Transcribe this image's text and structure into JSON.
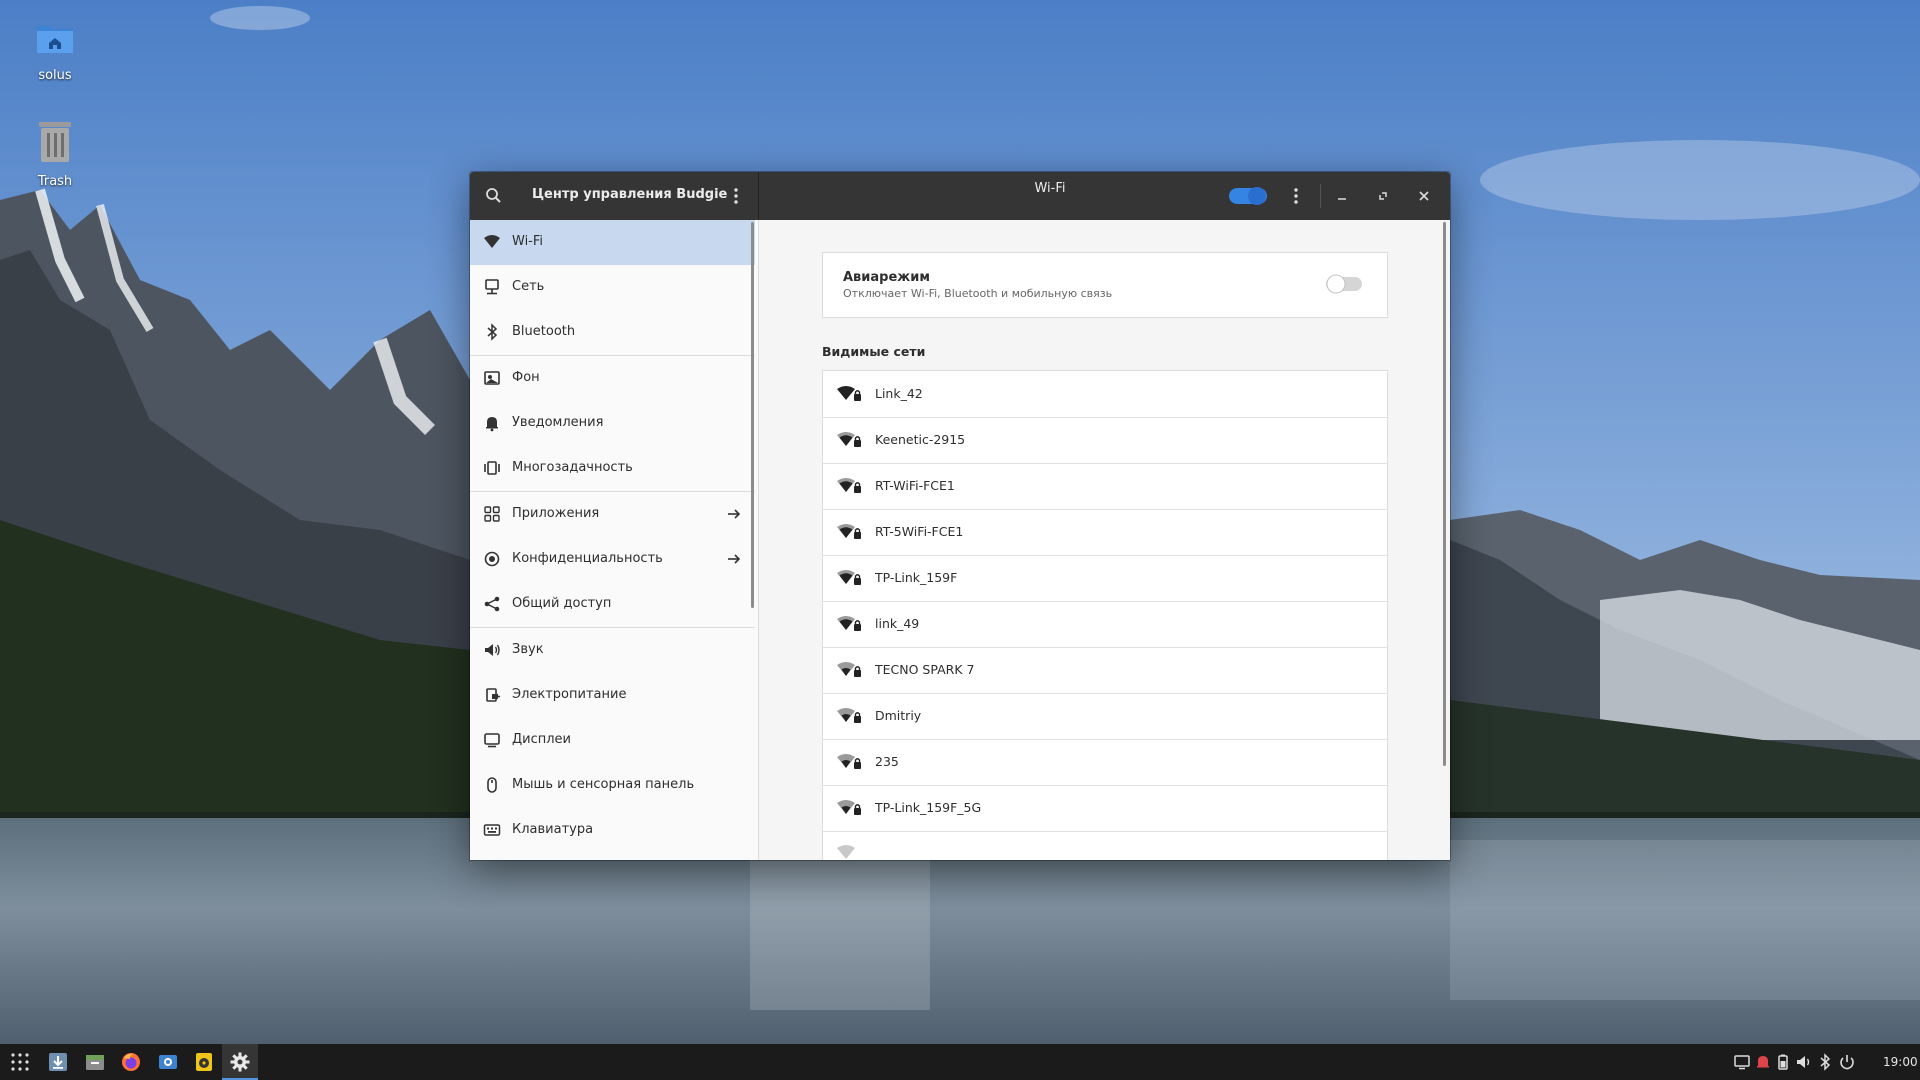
{
  "desktop": {
    "icons": [
      {
        "label": "solus",
        "icon": "home-folder-icon"
      },
      {
        "label": "Trash",
        "icon": "trash-icon"
      }
    ]
  },
  "window": {
    "app_title": "Центр управления Budgie",
    "page_title": "Wi-Fi",
    "wifi_enabled": true,
    "accent_color": "#3584e4"
  },
  "sidebar": {
    "items": [
      {
        "label": "Wi-Fi",
        "icon": "wifi-icon",
        "active": true
      },
      {
        "label": "Сеть",
        "icon": "network-icon"
      },
      {
        "label": "Bluetooth",
        "icon": "bluetooth-icon"
      },
      {
        "label": "Фон",
        "icon": "background-icon"
      },
      {
        "label": "Уведомления",
        "icon": "bell-icon"
      },
      {
        "label": "Многозадачность",
        "icon": "multitasking-icon"
      },
      {
        "label": "Приложения",
        "icon": "apps-grid-icon",
        "has_arrow": true
      },
      {
        "label": "Конфиденциальность",
        "icon": "privacy-icon",
        "has_arrow": true
      },
      {
        "label": "Общий доступ",
        "icon": "share-icon"
      },
      {
        "label": "Звук",
        "icon": "speaker-icon"
      },
      {
        "label": "Электропитание",
        "icon": "power-plug-icon"
      },
      {
        "label": "Дисплеи",
        "icon": "display-icon"
      },
      {
        "label": "Мышь и сенсорная панель",
        "icon": "mouse-icon"
      },
      {
        "label": "Клавиатура",
        "icon": "keyboard-icon"
      }
    ]
  },
  "content": {
    "airplane": {
      "title": "Авиарежим",
      "subtitle": "Отключает Wi-Fi, Bluetooth и мобильную связь",
      "enabled": false
    },
    "networks_heading": "Видимые сети",
    "networks": [
      {
        "name": "Link_42",
        "signal": 4,
        "secured": true
      },
      {
        "name": "Keenetic-2915",
        "signal": 3,
        "secured": true
      },
      {
        "name": "RT-WiFi-FCE1",
        "signal": 3,
        "secured": true
      },
      {
        "name": "RT-5WiFi-FCE1",
        "signal": 3,
        "secured": true
      },
      {
        "name": "TP-Link_159F",
        "signal": 3,
        "secured": true
      },
      {
        "name": "link_49",
        "signal": 3,
        "secured": true
      },
      {
        "name": "TECNO SPARK 7",
        "signal": 2,
        "secured": true
      },
      {
        "name": "Dmitriy",
        "signal": 2,
        "secured": true
      },
      {
        "name": "235",
        "signal": 2,
        "secured": true
      },
      {
        "name": "TP-Link_159F_5G",
        "signal": 2,
        "secured": true
      }
    ]
  },
  "taskbar": {
    "apps": [
      {
        "icon": "app-grid-icon",
        "active": false
      },
      {
        "icon": "downloads-icon",
        "active": false
      },
      {
        "icon": "files-icon",
        "active": false
      },
      {
        "icon": "firefox-icon",
        "active": false
      },
      {
        "icon": "screenshot-icon",
        "active": false
      },
      {
        "icon": "rhythmbox-icon",
        "active": false
      },
      {
        "icon": "settings-gear-icon",
        "active": true
      }
    ],
    "clock": "19:00"
  }
}
